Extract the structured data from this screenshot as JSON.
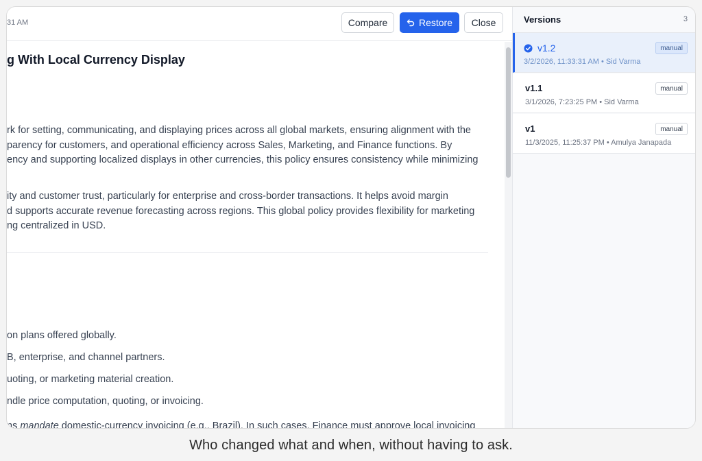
{
  "toolbar": {
    "timestamp": "31 AM",
    "compare_label": "Compare",
    "restore_label": "Restore",
    "close_label": "Close",
    "restore_icon": "undo-icon"
  },
  "document": {
    "title": "g With Local Currency Display",
    "para1": [
      "rk for setting, communicating, and displaying prices across all global markets, ensuring alignment with the",
      "parency for customers, and operational efficiency across Sales, Marketing, and Finance functions. By",
      "ency and supporting localized displays in other currencies, this policy ensures consistency while minimizing"
    ],
    "para2": [
      "ity and customer trust, particularly for enterprise and cross-border transactions. It helps avoid margin",
      "d supports accurate revenue forecasting across regions. This global policy provides flexibility for marketing",
      "ng centralized in USD."
    ],
    "list": [
      "on plans offered globally.",
      "B, enterprise, and channel partners.",
      "uoting, or marketing material creation.",
      "ndle price computation, quoting, or invoicing."
    ],
    "last_line_pre": "ns ",
    "last_line_em": "mandate",
    "last_line_post": " domestic-currency invoicing (e.g., Brazil). In such cases, Finance must approve local invoicing"
  },
  "versions": {
    "title": "Versions",
    "count": "3",
    "items": [
      {
        "label": "v1.2",
        "meta": "3/2/2026, 11:33:31 AM • Sid Varma",
        "badge": "manual",
        "selected": true,
        "icon": "check-circle-icon"
      },
      {
        "label": "v1.1",
        "meta": "3/1/2026, 7:23:25 PM • Sid Varma",
        "badge": "manual",
        "selected": false
      },
      {
        "label": "v1",
        "meta": "11/3/2025, 11:25:37 PM • Amulya Janapada",
        "badge": "manual",
        "selected": false
      }
    ]
  },
  "colors": {
    "accent": "#2563eb",
    "selected_bg": "#e9f0fb"
  },
  "caption": "Who changed what and when, without having to ask."
}
